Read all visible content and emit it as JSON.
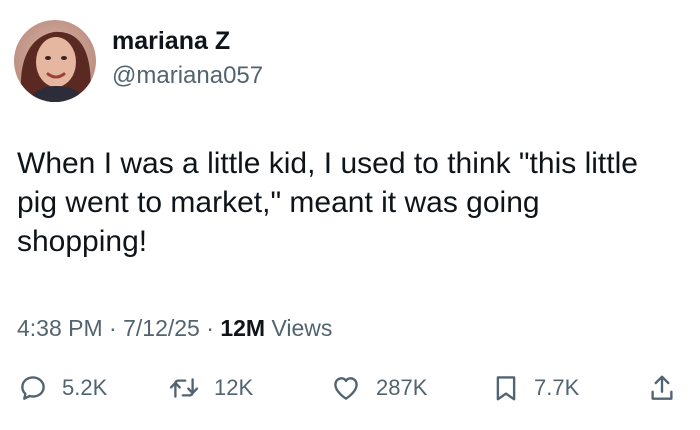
{
  "author": {
    "display_name": "mariana Z",
    "handle": "@mariana057"
  },
  "tweet": {
    "text": "When I was a little kid,  I used to think \"this little\npig went to market,\" meant it was going\nshopping!",
    "time": "4:38 PM",
    "date": "7/12/25",
    "separator": "·",
    "views_count": "12M",
    "views_label": "Views"
  },
  "actions": {
    "replies": {
      "icon": "reply-icon",
      "count": "5.2K"
    },
    "reposts": {
      "icon": "repost-icon",
      "count": "12K"
    },
    "likes": {
      "icon": "heart-icon",
      "count": "287K"
    },
    "bookmarks": {
      "icon": "bookmark-icon",
      "count": "7.7K"
    },
    "share": {
      "icon": "share-icon"
    }
  },
  "colors": {
    "text_primary": "#0f1419",
    "text_secondary": "#536471",
    "background": "#ffffff"
  }
}
